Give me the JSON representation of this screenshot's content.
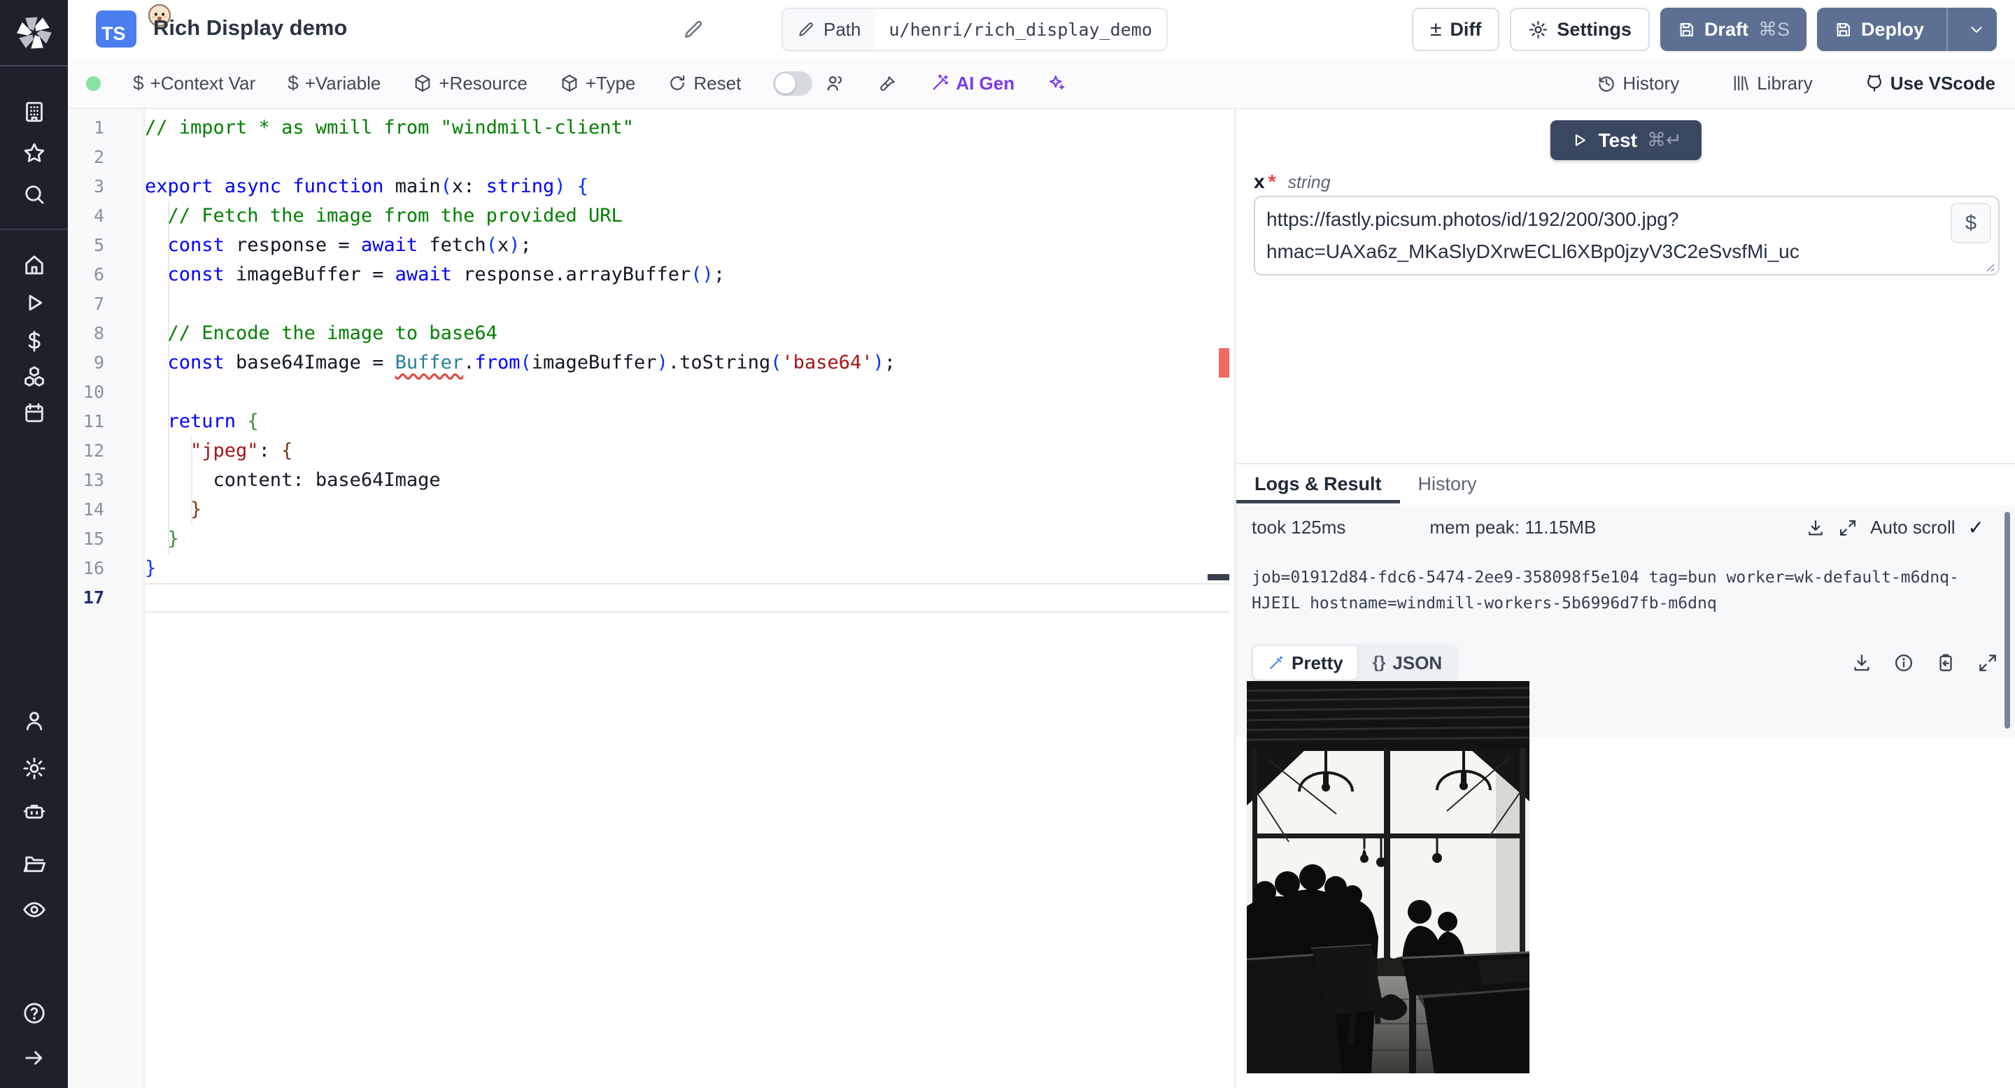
{
  "header": {
    "language_badge": "TS",
    "title": "Rich Display demo",
    "path_label": "Path",
    "path_value": "u/henri/rich_display_demo",
    "buttons": {
      "diff": "Diff",
      "diff_glyph": "±",
      "settings": "Settings",
      "draft": "Draft",
      "draft_shortcut": "⌘S",
      "deploy": "Deploy"
    }
  },
  "toolbar": {
    "context_var": "+Context Var",
    "variable": "+Variable",
    "resource": "+Resource",
    "type": "+Type",
    "reset": "Reset",
    "ai_gen": "AI Gen",
    "history": "History",
    "library": "Library",
    "vscode": "Use VScode",
    "dollar_glyph": "$"
  },
  "sidebar": {
    "icons": [
      "building",
      "star",
      "search",
      "home",
      "play",
      "dollar",
      "cubes",
      "calendar",
      "user",
      "settings",
      "robot",
      "folder",
      "eye",
      "help",
      "arrow-right"
    ]
  },
  "editor": {
    "lines": [
      {
        "n": 1,
        "s": [
          [
            "// import * as wmill from \"windmill-client\"",
            "cm"
          ]
        ]
      },
      {
        "n": 2,
        "s": []
      },
      {
        "n": 3,
        "s": [
          [
            "export async function",
            "kw"
          ],
          [
            " main",
            "plain"
          ],
          [
            "(",
            "b1"
          ],
          [
            "x",
            "plain"
          ],
          [
            ": ",
            "plain"
          ],
          [
            "string",
            "kw"
          ],
          [
            ")",
            "b1"
          ],
          [
            " ",
            "plain"
          ],
          [
            "{",
            "b1"
          ]
        ]
      },
      {
        "n": 4,
        "s": [
          [
            "  // Fetch the image from the provided URL",
            "cm"
          ]
        ]
      },
      {
        "n": 5,
        "s": [
          [
            "  ",
            "plain"
          ],
          [
            "const",
            "kw"
          ],
          [
            " response = ",
            "plain"
          ],
          [
            "await",
            "kw"
          ],
          [
            " fetch",
            "plain"
          ],
          [
            "(",
            "b1"
          ],
          [
            "x",
            "plain"
          ],
          [
            ")",
            "b1"
          ],
          [
            ";",
            "plain"
          ]
        ]
      },
      {
        "n": 6,
        "s": [
          [
            "  ",
            "plain"
          ],
          [
            "const",
            "kw"
          ],
          [
            " imageBuffer = ",
            "plain"
          ],
          [
            "await",
            "kw"
          ],
          [
            " response.arrayBuffer",
            "plain"
          ],
          [
            "()",
            "b1"
          ],
          [
            ";",
            "plain"
          ]
        ]
      },
      {
        "n": 7,
        "s": []
      },
      {
        "n": 8,
        "s": [
          [
            "  // Encode the image to base64",
            "cm"
          ]
        ]
      },
      {
        "n": 9,
        "s": [
          [
            "  ",
            "plain"
          ],
          [
            "const",
            "kw"
          ],
          [
            " base64Image = ",
            "plain"
          ],
          [
            "Buffer",
            "clsq"
          ],
          [
            ".",
            "plain"
          ],
          [
            "from",
            "kw"
          ],
          [
            "(",
            "b1"
          ],
          [
            "imageBuffer",
            "plain"
          ],
          [
            ")",
            "b1"
          ],
          [
            ".toString",
            "plain"
          ],
          [
            "(",
            "b1"
          ],
          [
            "'base64'",
            "str"
          ],
          [
            ")",
            "b1"
          ],
          [
            ";",
            "plain"
          ]
        ]
      },
      {
        "n": 10,
        "s": []
      },
      {
        "n": 11,
        "s": [
          [
            "  ",
            "plain"
          ],
          [
            "return",
            "kw"
          ],
          [
            " ",
            "plain"
          ],
          [
            "{",
            "b2"
          ]
        ]
      },
      {
        "n": 12,
        "s": [
          [
            "    ",
            "plain"
          ],
          [
            "\"jpeg\"",
            "str"
          ],
          [
            ": ",
            "plain"
          ],
          [
            "{",
            "b3"
          ]
        ]
      },
      {
        "n": 13,
        "s": [
          [
            "      content: base64Image",
            "plain"
          ]
        ]
      },
      {
        "n": 14,
        "s": [
          [
            "    ",
            "plain"
          ],
          [
            "}",
            "b3"
          ]
        ]
      },
      {
        "n": 15,
        "s": [
          [
            "  ",
            "plain"
          ],
          [
            "}",
            "b2"
          ]
        ]
      },
      {
        "n": 16,
        "s": [
          [
            "}",
            "b1"
          ]
        ]
      },
      {
        "n": 17,
        "s": [],
        "current": true
      }
    ]
  },
  "run_panel": {
    "test_label": "Test",
    "test_shortcut": "⌘↵",
    "arg_name": "x",
    "arg_required": "*",
    "arg_type": "string",
    "arg_value": "https://fastly.picsum.photos/id/192/200/300.jpg?hmac=UAXa6z_MKaSlyDXrwECLl6XBp0jzyV3C2eSvsfMi_uc",
    "var_picker": "$"
  },
  "logs": {
    "tab_logs": "Logs & Result",
    "tab_history": "History",
    "took": "took 125ms",
    "mem": "mem peak: 11.15MB",
    "autoscroll": "Auto scroll",
    "check_glyph": "✓",
    "lines": [
      "job=01912d84-fdc6-5474-2ee9-358098f5e104 tag=bun worker=wk-default-m6dnq-",
      "HJEIL hostname=windmill-workers-5b6996d7fb-m6dnq"
    ]
  },
  "result": {
    "tab_pretty": "Pretty",
    "tab_json": "JSON",
    "json_glyph": "{}",
    "image_description": "black and white photo of a cafe interior, people silhouetted at tables in front of large gridded windows with pendant lamps"
  },
  "colors": {
    "badge_blue": "#4a7df0",
    "slate_button": "#5d7094",
    "dark_button": "#3a4760",
    "ai_purple": "#7c3aed",
    "error_red": "#ef6b61",
    "run_green": "#86e29f"
  }
}
